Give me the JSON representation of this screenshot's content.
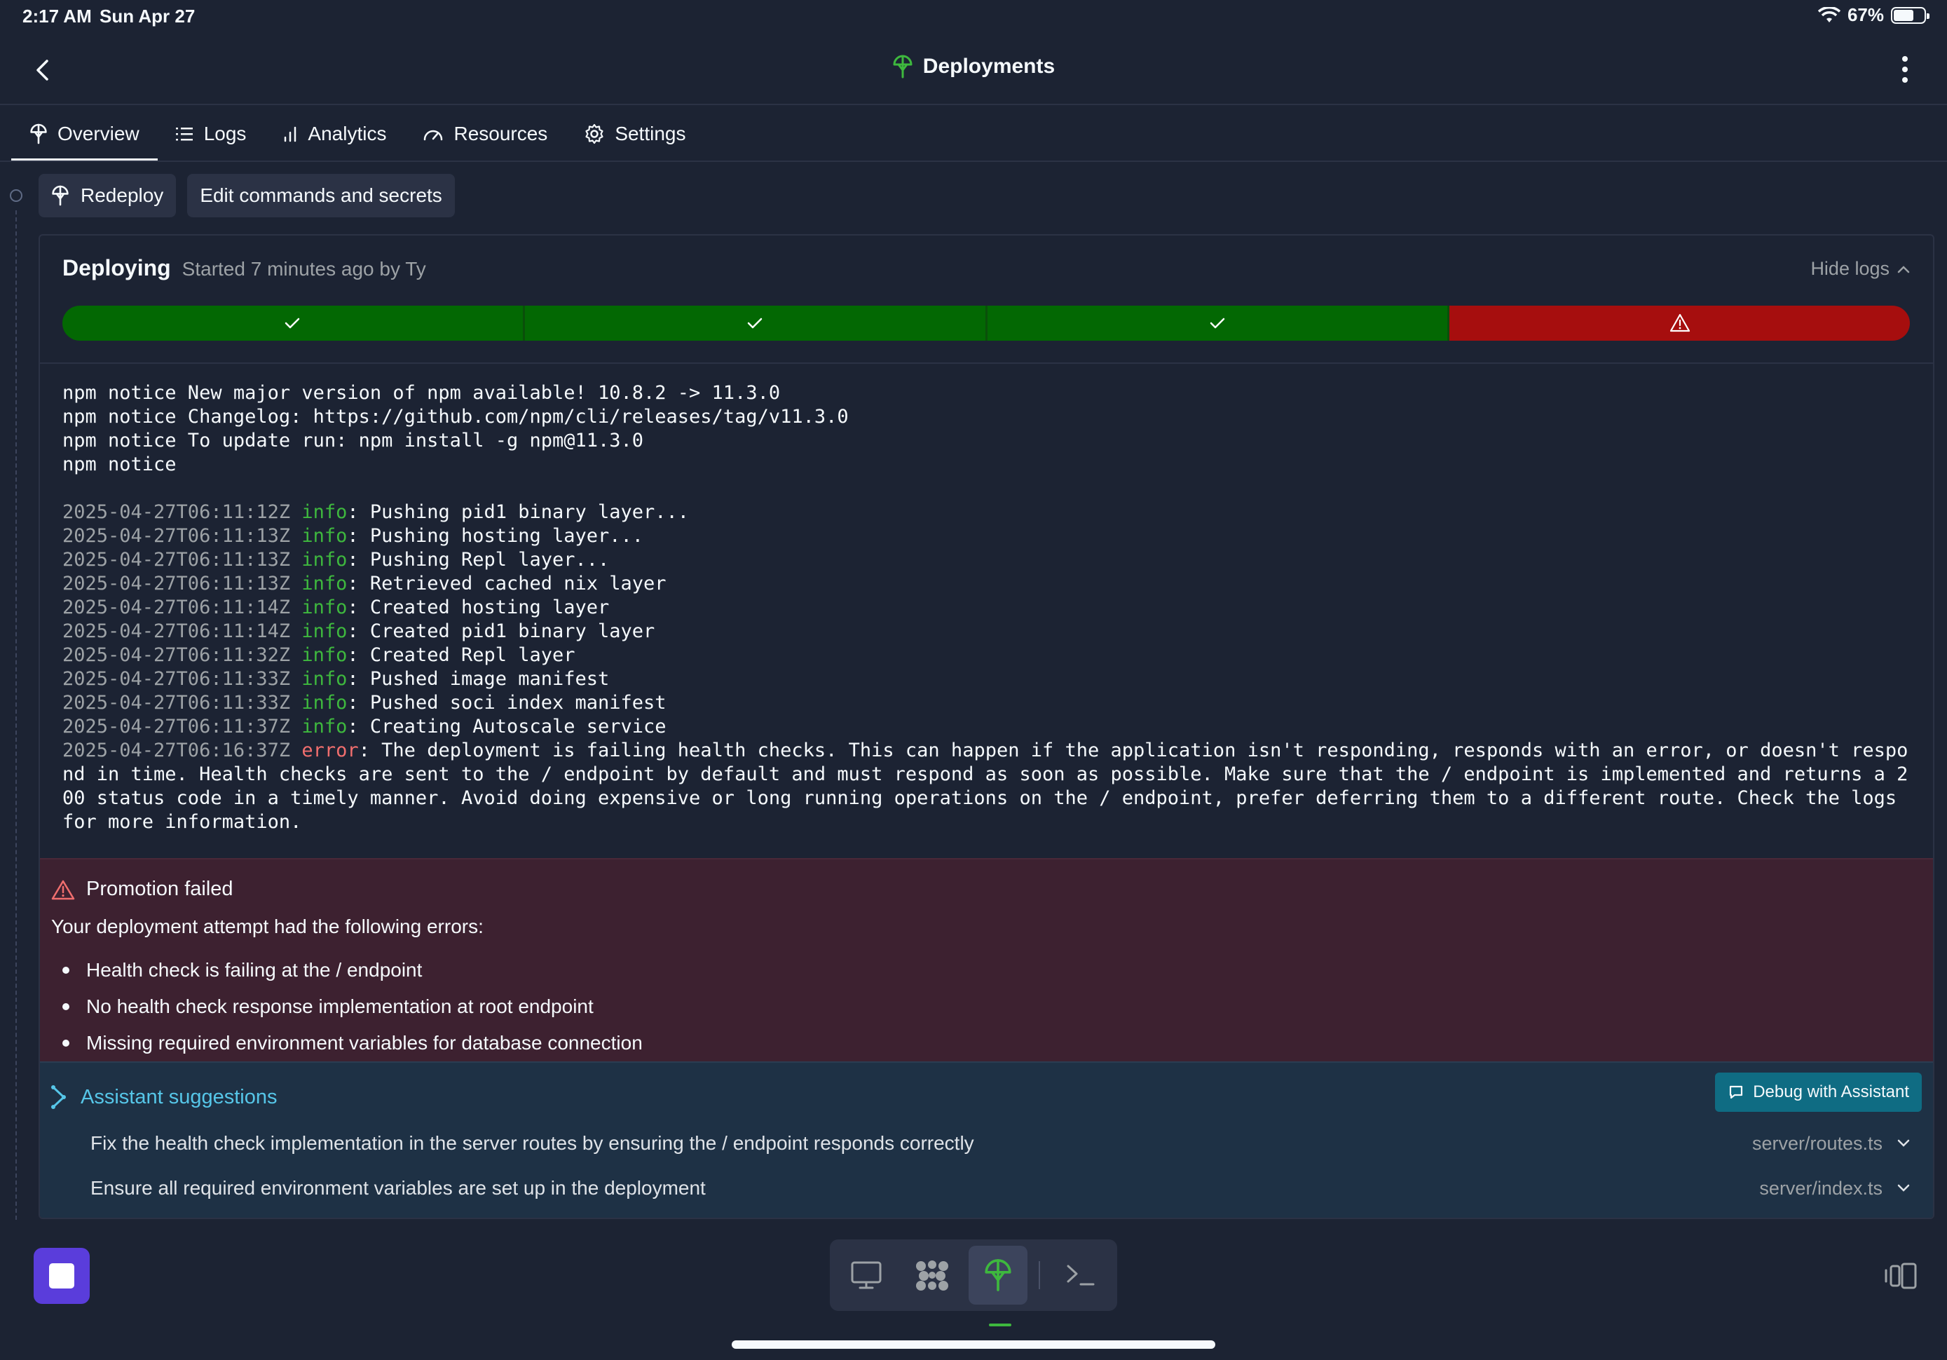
{
  "status_bar": {
    "time": "2:17 AM",
    "date": "Sun Apr 27",
    "battery": "67%"
  },
  "header": {
    "title": "Deployments"
  },
  "tabs": [
    {
      "label": "Overview",
      "icon": "deploy-icon",
      "active": true
    },
    {
      "label": "Logs",
      "icon": "list-icon",
      "active": false
    },
    {
      "label": "Analytics",
      "icon": "bar-chart-icon",
      "active": false
    },
    {
      "label": "Resources",
      "icon": "gauge-icon",
      "active": false
    },
    {
      "label": "Settings",
      "icon": "gear-icon",
      "active": false
    }
  ],
  "actions": {
    "redeploy": "Redeploy",
    "edit": "Edit commands and secrets"
  },
  "deployment": {
    "status": "Deploying",
    "meta": "Started 7 minutes ago by Ty",
    "hide_logs": "Hide logs",
    "steps": [
      "success",
      "success",
      "success",
      "error"
    ],
    "colors": {
      "success": "#036803",
      "error": "#a60e0e"
    }
  },
  "logs": {
    "npm": [
      "npm notice New major version of npm available! 10.8.2 -> 11.3.0",
      "npm notice Changelog: https://github.com/npm/cli/releases/tag/v11.3.0",
      "npm notice To update run: npm install -g npm@11.3.0",
      "npm notice"
    ],
    "entries": [
      {
        "ts": "2025-04-27T06:11:12Z",
        "level": "info",
        "msg": ": Pushing pid1 binary layer..."
      },
      {
        "ts": "2025-04-27T06:11:13Z",
        "level": "info",
        "msg": ": Pushing hosting layer..."
      },
      {
        "ts": "2025-04-27T06:11:13Z",
        "level": "info",
        "msg": ": Pushing Repl layer..."
      },
      {
        "ts": "2025-04-27T06:11:13Z",
        "level": "info",
        "msg": ": Retrieved cached nix layer"
      },
      {
        "ts": "2025-04-27T06:11:14Z",
        "level": "info",
        "msg": ": Created hosting layer"
      },
      {
        "ts": "2025-04-27T06:11:14Z",
        "level": "info",
        "msg": ": Created pid1 binary layer"
      },
      {
        "ts": "2025-04-27T06:11:32Z",
        "level": "info",
        "msg": ": Created Repl layer"
      },
      {
        "ts": "2025-04-27T06:11:33Z",
        "level": "info",
        "msg": ": Pushed image manifest"
      },
      {
        "ts": "2025-04-27T06:11:33Z",
        "level": "info",
        "msg": ": Pushed soci index manifest"
      },
      {
        "ts": "2025-04-27T06:11:37Z",
        "level": "info",
        "msg": ": Creating Autoscale service"
      },
      {
        "ts": "2025-04-27T06:16:37Z",
        "level": "error",
        "msg": ": The deployment is failing health checks. This can happen if the application isn't responding, responds with an error, or doesn't respond in time. Health checks are sent to the / endpoint by default and must respond as soon as possible. Make sure that the / endpoint is implemented and returns a 200 status code in a timely manner. Avoid doing expensive or long running operations on the / endpoint, prefer deferring them to a different route. Check the logs for more information."
      }
    ]
  },
  "promotion": {
    "title": "Promotion failed",
    "intro": "Your deployment attempt had the following errors:",
    "errors": [
      "Health check is failing at the / endpoint",
      "No health check response implementation at root endpoint",
      "Missing required environment variables for database connection"
    ]
  },
  "assistant": {
    "title": "Assistant suggestions",
    "debug_button": "Debug with Assistant",
    "suggestions": [
      {
        "text": "Fix the health check implementation in the server routes by ensuring the / endpoint responds correctly",
        "file": "server/routes.ts"
      },
      {
        "text": "Ensure all required environment variables are set up in the deployment",
        "file": "server/index.ts"
      }
    ]
  },
  "dock": {
    "items": [
      "monitor-icon",
      "grid-blob-icon",
      "deploy-icon",
      "terminal-icon"
    ],
    "active": "deploy-icon"
  }
}
